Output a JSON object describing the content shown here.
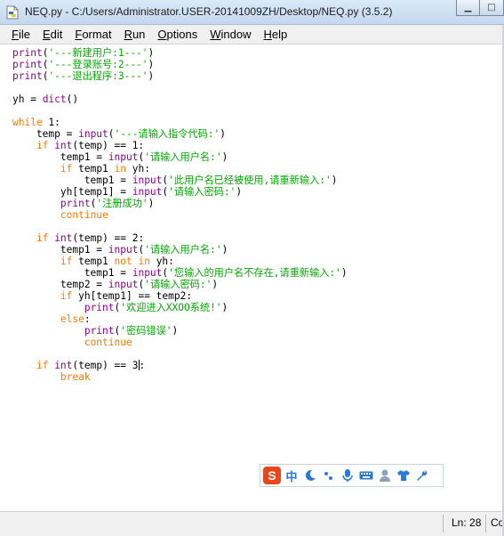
{
  "window": {
    "title": "NEQ.py - C:/Users/Administrator.USER-20141009ZH/Desktop/NEQ.py (3.5.2)",
    "minimize_glyph": "▁",
    "maximize_glyph": "□"
  },
  "menu": [
    {
      "key": "F",
      "rest": "ile"
    },
    {
      "key": "E",
      "rest": "dit"
    },
    {
      "key": "F",
      "rest": "ormat"
    },
    {
      "key": "R",
      "rest": "un"
    },
    {
      "key": "O",
      "rest": "ptions"
    },
    {
      "key": "W",
      "rest": "indow"
    },
    {
      "key": "H",
      "rest": "elp"
    }
  ],
  "code_lines": [
    [
      [
        "bi",
        "print"
      ],
      [
        "",
        "("
      ],
      [
        "st",
        "'---新建用户:1---'"
      ],
      [
        "",
        ")"
      ]
    ],
    [
      [
        "bi",
        "print"
      ],
      [
        "",
        "("
      ],
      [
        "st",
        "'---登录账号:2---'"
      ],
      [
        "",
        ")"
      ]
    ],
    [
      [
        "bi",
        "print"
      ],
      [
        "",
        "("
      ],
      [
        "st",
        "'---退出程序:3---'"
      ],
      [
        "",
        ")"
      ]
    ],
    [],
    [
      [
        "",
        "yh = "
      ],
      [
        "bi",
        "dict"
      ],
      [
        "",
        "()"
      ]
    ],
    [],
    [
      [
        "kw",
        "while"
      ],
      [
        "",
        " 1:"
      ]
    ],
    [
      [
        "",
        "    temp = "
      ],
      [
        "bi",
        "input"
      ],
      [
        "",
        "("
      ],
      [
        "st",
        "'---请输入指令代码:'"
      ],
      [
        "",
        ")"
      ]
    ],
    [
      [
        "",
        "    "
      ],
      [
        "kw",
        "if"
      ],
      [
        "",
        " "
      ],
      [
        "bi",
        "int"
      ],
      [
        "",
        "(temp) == 1:"
      ]
    ],
    [
      [
        "",
        "        temp1 = "
      ],
      [
        "bi",
        "input"
      ],
      [
        "",
        "("
      ],
      [
        "st",
        "'请输入用户名:'"
      ],
      [
        "",
        ")"
      ]
    ],
    [
      [
        "",
        "        "
      ],
      [
        "kw",
        "if"
      ],
      [
        "",
        " temp1 "
      ],
      [
        "kw",
        "in"
      ],
      [
        "",
        " yh:"
      ]
    ],
    [
      [
        "",
        "            temp1 = "
      ],
      [
        "bi",
        "input"
      ],
      [
        "",
        "("
      ],
      [
        "st",
        "'此用户名已经被使用,请重新输入:'"
      ],
      [
        "",
        ")"
      ]
    ],
    [
      [
        "",
        "        yh[temp1] = "
      ],
      [
        "bi",
        "input"
      ],
      [
        "",
        "("
      ],
      [
        "st",
        "'请输入密码:'"
      ],
      [
        "",
        ")"
      ]
    ],
    [
      [
        "",
        "        "
      ],
      [
        "bi",
        "print"
      ],
      [
        "",
        "("
      ],
      [
        "st",
        "'注册成功'"
      ],
      [
        "",
        ")"
      ]
    ],
    [
      [
        "",
        "        "
      ],
      [
        "kw",
        "continue"
      ]
    ],
    [],
    [
      [
        "",
        "    "
      ],
      [
        "kw",
        "if"
      ],
      [
        "",
        " "
      ],
      [
        "bi",
        "int"
      ],
      [
        "",
        "(temp) == 2:"
      ]
    ],
    [
      [
        "",
        "        temp1 = "
      ],
      [
        "bi",
        "input"
      ],
      [
        "",
        "("
      ],
      [
        "st",
        "'请输入用户名:'"
      ],
      [
        "",
        ")"
      ]
    ],
    [
      [
        "",
        "        "
      ],
      [
        "kw",
        "if"
      ],
      [
        "",
        " temp1 "
      ],
      [
        "kw",
        "not in"
      ],
      [
        "",
        " yh:"
      ]
    ],
    [
      [
        "",
        "            temp1 = "
      ],
      [
        "bi",
        "input"
      ],
      [
        "",
        "("
      ],
      [
        "st",
        "'您输入的用户名不存在,请重新输入:'"
      ],
      [
        "",
        ")"
      ]
    ],
    [
      [
        "",
        "        temp2 = "
      ],
      [
        "bi",
        "input"
      ],
      [
        "",
        "("
      ],
      [
        "st",
        "'请输入密码:'"
      ],
      [
        "",
        ")"
      ]
    ],
    [
      [
        "",
        "        "
      ],
      [
        "kw",
        "if"
      ],
      [
        "",
        " yh[temp1] == temp2:"
      ]
    ],
    [
      [
        "",
        "            "
      ],
      [
        "bi",
        "print"
      ],
      [
        "",
        "("
      ],
      [
        "st",
        "'欢迎进入XXOO系统!'"
      ],
      [
        "",
        ")"
      ]
    ],
    [
      [
        "",
        "        "
      ],
      [
        "kw",
        "else"
      ],
      [
        "",
        ":"
      ]
    ],
    [
      [
        "",
        "            "
      ],
      [
        "bi",
        "print"
      ],
      [
        "",
        "("
      ],
      [
        "st",
        "'密码错误'"
      ],
      [
        "",
        ")"
      ]
    ],
    [
      [
        "",
        "            "
      ],
      [
        "kw",
        "continue"
      ]
    ],
    [],
    [
      [
        "",
        "    "
      ],
      [
        "kw",
        "if"
      ],
      [
        "",
        " "
      ],
      [
        "bi",
        "int"
      ],
      [
        "",
        "(temp) == 3"
      ],
      [
        "cursor",
        ""
      ],
      [
        "",
        ":"
      ]
    ],
    [
      [
        "",
        "        "
      ],
      [
        "kw",
        "break"
      ]
    ]
  ],
  "colors": {
    "keyword": "#ff7700",
    "builtin": "#900090",
    "string": "#00aa00"
  },
  "ime": {
    "logo": "S",
    "mode": "中",
    "icons": [
      "moon-icon",
      "punctuation-icon",
      "microphone-icon",
      "keyboard-icon",
      "user-icon",
      "shirt-icon",
      "wrench-icon"
    ]
  },
  "status": {
    "line": "Ln: 28",
    "col": "Co"
  }
}
